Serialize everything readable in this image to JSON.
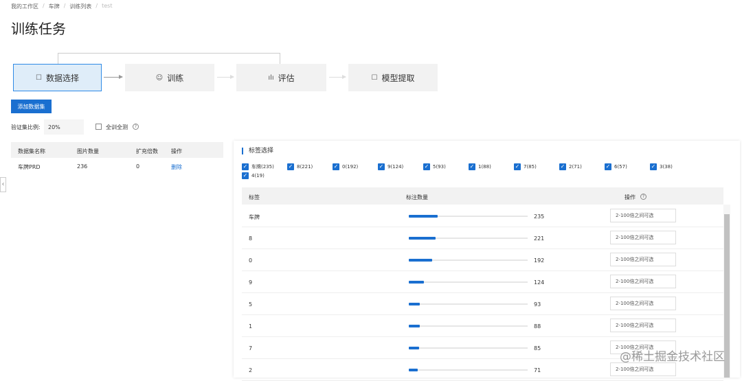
{
  "breadcrumb": [
    "我的工作区",
    "车牌",
    "训练列表",
    "test"
  ],
  "page_title": "训练任务",
  "steps": [
    {
      "label": "数据选择",
      "icon": "data-select-icon",
      "glyph": "☐"
    },
    {
      "label": "训练",
      "icon": "train-icon",
      "glyph": "☺"
    },
    {
      "label": "评估",
      "icon": "evaluate-icon",
      "glyph": "ılı"
    },
    {
      "label": "模型提取",
      "icon": "model-extract-icon",
      "glyph": "☐"
    }
  ],
  "add_dataset_button": "添加数据集",
  "validation": {
    "label": "验证集比例:",
    "value": "20%",
    "all_train_label": "全训全测",
    "help": "?"
  },
  "dataset_table": {
    "headers": [
      "数据集名称",
      "图片数量",
      "扩充倍数",
      "操作"
    ],
    "rows": [
      {
        "name": "车牌PRD",
        "count": "236",
        "multiplier": "0",
        "action": "删除"
      }
    ]
  },
  "label_panel": {
    "title": "标签选择",
    "tags": [
      "车牌(235)",
      "8(221)",
      "0(192)",
      "9(124)",
      "5(93)",
      "1(88)",
      "7(85)",
      "2(71)",
      "6(57)",
      "3(38)",
      "4(19)"
    ],
    "headers": {
      "label": "标签",
      "count": "标注数量",
      "action": "操作",
      "help": "?"
    },
    "max_count": 235,
    "rows": [
      {
        "label": "车牌",
        "count": 235,
        "count_text": "235",
        "placeholder": "2-100倍之间可选"
      },
      {
        "label": "8",
        "count": 221,
        "count_text": "221",
        "placeholder": "2-100倍之间可选"
      },
      {
        "label": "0",
        "count": 192,
        "count_text": "192",
        "placeholder": "2-100倍之间可选"
      },
      {
        "label": "9",
        "count": 124,
        "count_text": "124",
        "placeholder": "2-100倍之间可选"
      },
      {
        "label": "5",
        "count": 93,
        "count_text": "93",
        "placeholder": "2-100倍之间可选"
      },
      {
        "label": "1",
        "count": 88,
        "count_text": "88",
        "placeholder": "2-100倍之间可选"
      },
      {
        "label": "7",
        "count": 85,
        "count_text": "85",
        "placeholder": "2-100倍之间可选"
      },
      {
        "label": "2",
        "count": 71,
        "count_text": "71",
        "placeholder": "2-100倍之间可选"
      }
    ]
  },
  "collapse_glyph": "‹",
  "watermark": "@稀土掘金技术社区",
  "colors": {
    "accent": "#1a6fd0",
    "active_step_bg": "#dfedf9"
  }
}
